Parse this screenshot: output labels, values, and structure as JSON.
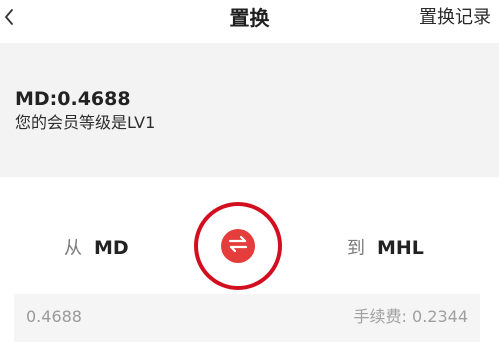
{
  "header": {
    "back_icon": "chevron-left-icon",
    "title": "置换",
    "history_label": "置换记录"
  },
  "account": {
    "balance_text": "MD:0.4688",
    "member_level_text": "您的会员等级是LV1"
  },
  "exchange": {
    "from_prefix": "从",
    "from_token": "MD",
    "to_prefix": "到",
    "to_token": "MHL",
    "swap_icon": "swap-arrows-icon",
    "highlight_color": "#d30f1f",
    "button_color": "#e53c3c"
  },
  "amount": {
    "value": "0.4688",
    "fee_text": "手续费: 0.2344"
  }
}
